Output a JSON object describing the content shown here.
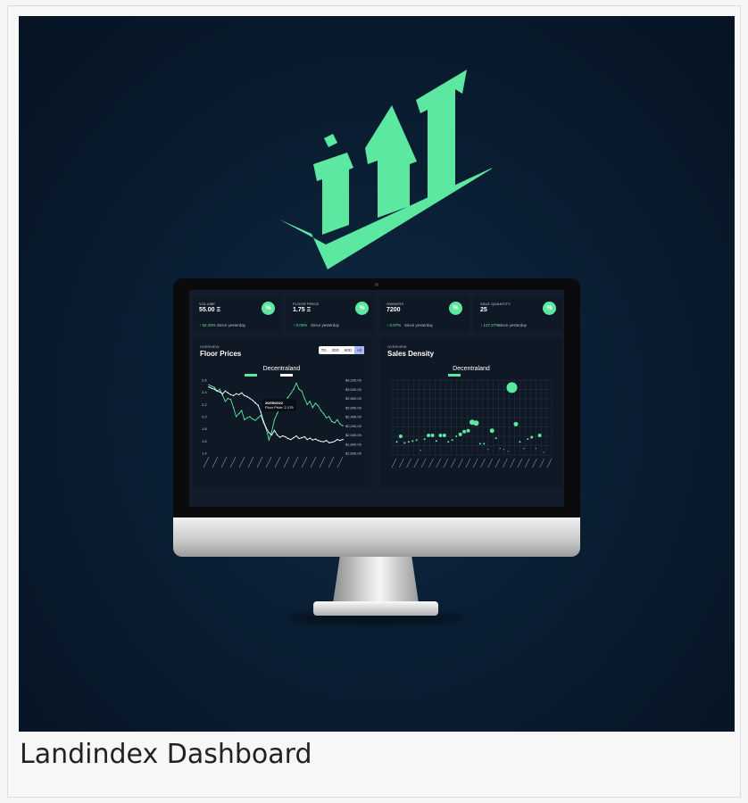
{
  "caption": "Landindex Dashboard",
  "colors": {
    "accent": "#5ce8a0",
    "screen_bg": "#121c2a",
    "card_bg": "#0f1825"
  },
  "stats": [
    {
      "label": "VOLUME",
      "value": "55.00 Ξ",
      "change": "↑ 52.28%",
      "since": "Since yesterday",
      "icon": "%"
    },
    {
      "label": "FLOOR PRICE",
      "value": "1.75 Ξ",
      "change": "↑ 0.00%",
      "since": "Since yesterday",
      "icon": "%"
    },
    {
      "label": "OWNERS",
      "value": "7200",
      "change": "↑ 0.07%",
      "since": "Since yesterday",
      "icon": "%"
    },
    {
      "label": "SALE QUANTITY",
      "value": "25",
      "change": "↑ 127.27%",
      "since": "Since yesterday",
      "icon": "%"
    }
  ],
  "floor_panel": {
    "overview": "OVERVIEW",
    "title": "Floor Prices",
    "ranges": [
      "7D",
      "30D",
      "90D",
      "All"
    ],
    "active_range": "All",
    "chart_title": "Decentraland",
    "tooltip_date": "20/05/2022",
    "tooltip_value": "Floor Price: 2.175"
  },
  "density_panel": {
    "overview": "OVERVIEW",
    "title": "Sales Density",
    "chart_title": "Decentraland"
  },
  "chart_data": [
    {
      "type": "line",
      "title": "Decentraland",
      "y_left_ticks": [
        "2.6",
        "2.4",
        "2.2",
        "2.0",
        "1.8",
        "1.6",
        "1.4"
      ],
      "y_right_ticks": [
        "$3,200.00",
        "$3,000.00",
        "$2,800.00",
        "$2,600.00",
        "$2,400.00",
        "$2,200.00",
        "$2,000.00",
        "$1,800.00",
        "$1,600.00"
      ],
      "ylim_left": [
        1.4,
        2.6
      ],
      "ylim_right": [
        1600,
        3200
      ],
      "series": [
        {
          "color": "#5ce8a0",
          "axis": "left",
          "values": [
            2.52,
            2.5,
            2.48,
            2.42,
            2.45,
            2.35,
            2.25,
            2.3,
            2.28,
            2.15,
            2.0,
            2.05,
            2.1,
            1.95,
            1.98,
            2.0,
            1.96,
            1.94,
            1.98,
            2.02,
            1.9,
            1.8,
            1.62,
            1.75,
            1.95,
            2.05,
            2.15,
            2.18,
            2.25,
            2.32,
            2.38,
            2.45,
            2.55,
            2.45,
            2.42,
            2.3,
            2.2,
            2.25,
            2.15,
            2.22,
            2.18,
            2.1,
            2.05,
            1.98,
            2.0,
            1.92,
            1.9,
            1.95,
            1.88,
            1.85
          ]
        },
        {
          "color": "#ffffff",
          "axis": "right",
          "values": [
            3050,
            3020,
            3000,
            2960,
            2940,
            2900,
            2960,
            2920,
            2880,
            2860,
            2900,
            2880,
            2920,
            2860,
            2840,
            2800,
            2760,
            2700,
            2650,
            2500,
            2300,
            2150,
            2050,
            2000,
            2100,
            2000,
            1950,
            1980,
            1960,
            1920,
            1900,
            1940,
            1980,
            1920,
            1940,
            1960,
            1900,
            1930,
            1890,
            1910,
            1880,
            1860,
            1850,
            1880,
            1830,
            1840,
            1860,
            1900,
            1880,
            1900
          ]
        }
      ]
    },
    {
      "type": "scatter",
      "title": "Decentraland",
      "xlim": [
        0,
        40
      ],
      "ylim": [
        0,
        80
      ],
      "points": [
        {
          "x": 1,
          "y": 14,
          "r": 1
        },
        {
          "x": 2,
          "y": 20,
          "r": 2
        },
        {
          "x": 3,
          "y": 13,
          "r": 1
        },
        {
          "x": 4,
          "y": 14,
          "r": 1
        },
        {
          "x": 5,
          "y": 15,
          "r": 1
        },
        {
          "x": 6,
          "y": 16,
          "r": 1
        },
        {
          "x": 7,
          "y": 5,
          "r": 0.5
        },
        {
          "x": 8,
          "y": 17,
          "r": 1
        },
        {
          "x": 9,
          "y": 21,
          "r": 2
        },
        {
          "x": 10,
          "y": 21,
          "r": 2
        },
        {
          "x": 11,
          "y": 15,
          "r": 1
        },
        {
          "x": 12,
          "y": 21,
          "r": 2
        },
        {
          "x": 13,
          "y": 21,
          "r": 2
        },
        {
          "x": 14,
          "y": 14,
          "r": 1
        },
        {
          "x": 15,
          "y": 16,
          "r": 1
        },
        {
          "x": 16,
          "y": 20,
          "r": 1
        },
        {
          "x": 17,
          "y": 22,
          "r": 2
        },
        {
          "x": 18,
          "y": 25,
          "r": 2
        },
        {
          "x": 19,
          "y": 26,
          "r": 2
        },
        {
          "x": 20,
          "y": 35,
          "r": 3
        },
        {
          "x": 21,
          "y": 34,
          "r": 3
        },
        {
          "x": 22,
          "y": 12,
          "r": 1
        },
        {
          "x": 23,
          "y": 12,
          "r": 1
        },
        {
          "x": 24,
          "y": 6,
          "r": 0.5
        },
        {
          "x": 25,
          "y": 26,
          "r": 2.5
        },
        {
          "x": 26,
          "y": 18,
          "r": 1
        },
        {
          "x": 27,
          "y": 7,
          "r": 0.5
        },
        {
          "x": 28,
          "y": 6,
          "r": 0.5
        },
        {
          "x": 29,
          "y": 4,
          "r": 0.5
        },
        {
          "x": 30,
          "y": 72,
          "r": 6
        },
        {
          "x": 31,
          "y": 33,
          "r": 2.5
        },
        {
          "x": 32,
          "y": 14,
          "r": 1
        },
        {
          "x": 33,
          "y": 7,
          "r": 0.5
        },
        {
          "x": 34,
          "y": 17,
          "r": 1
        },
        {
          "x": 35,
          "y": 19,
          "r": 1.5
        },
        {
          "x": 36,
          "y": 7,
          "r": 0.5
        },
        {
          "x": 37,
          "y": 21,
          "r": 2
        },
        {
          "x": 38,
          "y": 3,
          "r": 0.5
        }
      ]
    }
  ]
}
